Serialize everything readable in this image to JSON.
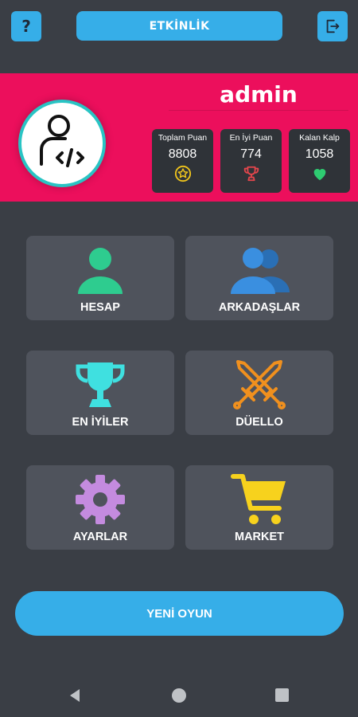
{
  "topbar": {
    "help_label": "?",
    "event_label": "ETKİNLİK"
  },
  "profile": {
    "username": "admin",
    "stats": [
      {
        "label": "Toplam Puan",
        "value": "8808",
        "icon": "star-icon",
        "color": "#f0c51c"
      },
      {
        "label": "En İyi Puan",
        "value": "774",
        "icon": "trophy-icon",
        "color": "#e4464c"
      },
      {
        "label": "Kalan Kalp",
        "value": "1058",
        "icon": "heart-icon",
        "color": "#2ecc71"
      }
    ]
  },
  "menu": [
    {
      "label": "HESAP",
      "icon": "user-icon",
      "color": "#2ecc8f"
    },
    {
      "label": "ARKADAŞLAR",
      "icon": "friends-icon",
      "color": "#3a8fe0"
    },
    {
      "label": "EN İYİLER",
      "icon": "trophy-icon",
      "color": "#3fe0e0"
    },
    {
      "label": "DÜELLO",
      "icon": "crossed-swords-icon",
      "color": "#f0901e"
    },
    {
      "label": "AYARLAR",
      "icon": "gear-icon",
      "color": "#c48bdf"
    },
    {
      "label": "MARKET",
      "icon": "cart-icon",
      "color": "#f7d21d"
    }
  ],
  "new_game_label": "YENİ OYUN",
  "colors": {
    "background": "#3a3e45",
    "accent": "#36aee8",
    "profile_band": "#ec0f5c",
    "tile": "#4f535c"
  }
}
